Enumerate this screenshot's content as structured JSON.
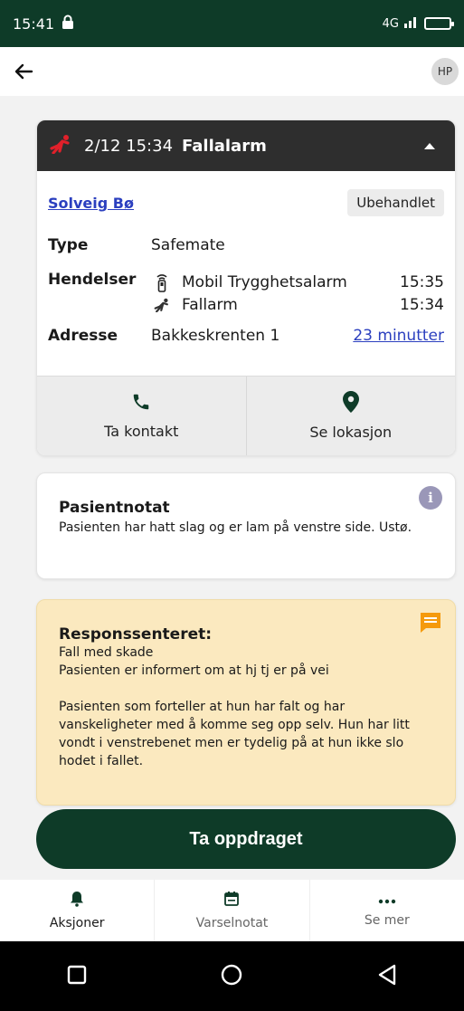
{
  "status_bar": {
    "time": "15:41",
    "signal_text": "4G"
  },
  "app_bar": {
    "avatar_initials": "HP"
  },
  "alarm": {
    "date": "2/12 15:34",
    "title": "Fallalarm",
    "patient_name": "Solveig Bø",
    "status": "Ubehandlet",
    "type_label": "Type",
    "type_value": "Safemate",
    "events_label": "Hendelser",
    "events": [
      {
        "name": "Mobil Trygghetsalarm",
        "time": "15:35",
        "icon": "mobile-alarm-icon"
      },
      {
        "name": "Fallarm",
        "time": "15:34",
        "icon": "fall-icon"
      }
    ],
    "address_label": "Adresse",
    "address_value": "Bakkeskrenten 1",
    "distance": "23 minutter",
    "actions": {
      "contact": "Ta kontakt",
      "location": "Se lokasjon"
    }
  },
  "patient_note": {
    "title": "Pasientnotat",
    "text": "Pasienten har hatt slag og er lam på venstre side. Ustø."
  },
  "response_center": {
    "title": "Responssenteret:",
    "line1": "Fall med skade",
    "line2": "Pasienten er informert om at hj tj er på vei",
    "paragraph": "Pasienten som forteller at hun har falt og har vanskeligheter med å komme seg opp selv. Hun har litt vondt i venstrebenet men er tydelig på at hun ikke slo hodet i fallet."
  },
  "cta_label": "Ta oppdraget",
  "bottom_nav": {
    "actions": "Aksjoner",
    "notes": "Varselnotat",
    "more": "Se mer"
  },
  "colors": {
    "primary": "#0e3b28",
    "alarm_red": "#e0202a",
    "link": "#2b3fbf",
    "response_bg": "#fbe9bf",
    "chat_icon": "#f59a0c"
  }
}
